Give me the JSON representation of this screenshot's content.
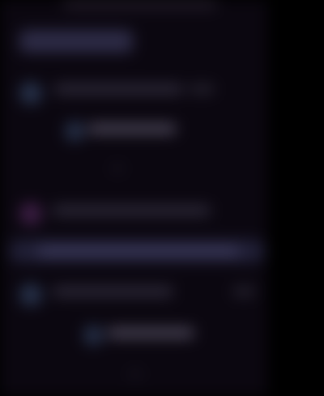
{
  "theme": {
    "background": "#0b0710",
    "accent": "#2d2b46",
    "purple": "#3d1e45",
    "avatar": "#27324b"
  },
  "ui": {
    "blurred": true,
    "sections": [
      {
        "name": "top-pill"
      },
      {
        "name": "message-row-1"
      },
      {
        "name": "nested-row-1"
      },
      {
        "name": "message-row-2"
      },
      {
        "name": "highlight-band"
      },
      {
        "name": "message-row-3"
      },
      {
        "name": "nested-row-2"
      }
    ]
  }
}
